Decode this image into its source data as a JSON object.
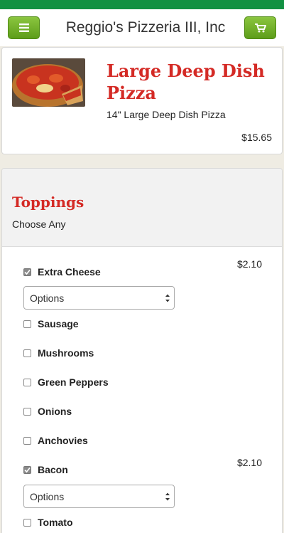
{
  "header": {
    "title": "Reggio's Pizzeria III, Inc",
    "menu_icon": "hamburger-menu-icon",
    "cart_icon": "shopping-cart-icon"
  },
  "product": {
    "title": "Large Deep Dish Pizza",
    "description": "14\" Large Deep Dish Pizza",
    "price": "$15.65",
    "image": "deep-dish-pizza-photo"
  },
  "toppings": {
    "title": "Toppings",
    "subtitle": "Choose Any",
    "items": [
      {
        "label": "Extra Cheese",
        "checked": true,
        "price": "$2.10",
        "options": "Options"
      },
      {
        "label": "Sausage",
        "checked": false
      },
      {
        "label": "Mushrooms",
        "checked": false
      },
      {
        "label": "Green Peppers",
        "checked": false
      },
      {
        "label": "Onions",
        "checked": false
      },
      {
        "label": "Anchovies",
        "checked": false
      },
      {
        "label": "Bacon",
        "checked": true,
        "price": "$2.10",
        "options": "Options"
      },
      {
        "label": "Tomato",
        "checked": false
      }
    ]
  },
  "colors": {
    "brand_green": "#129142",
    "button_green": "#6aad22",
    "accent_red": "#d42a25"
  }
}
